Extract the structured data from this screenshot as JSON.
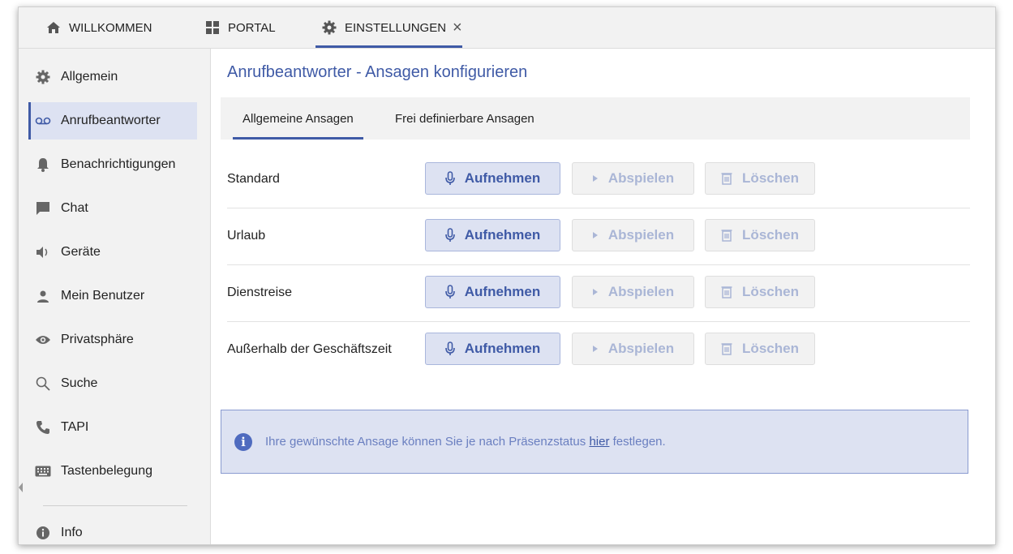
{
  "top_tabs": [
    {
      "label": "WILLKOMMEN",
      "icon": "home-icon"
    },
    {
      "label": "PORTAL",
      "icon": "grid-icon"
    },
    {
      "label": "EINSTELLUNGEN",
      "icon": "gear-icon",
      "active": true,
      "closable": true
    }
  ],
  "sidebar": {
    "items": [
      {
        "label": "Allgemein",
        "icon": "gear-icon"
      },
      {
        "label": "Anrufbeantworter",
        "icon": "voicemail-icon",
        "active": true
      },
      {
        "label": "Benachrichtigungen",
        "icon": "bell-icon"
      },
      {
        "label": "Chat",
        "icon": "chat-icon"
      },
      {
        "label": "Geräte",
        "icon": "speaker-icon"
      },
      {
        "label": "Mein Benutzer",
        "icon": "user-icon"
      },
      {
        "label": "Privatsphäre",
        "icon": "eye-icon"
      },
      {
        "label": "Suche",
        "icon": "search-icon"
      },
      {
        "label": "TAPI",
        "icon": "phone-icon"
      },
      {
        "label": "Tastenbelegung",
        "icon": "keyboard-icon"
      },
      {
        "label": "Info",
        "icon": "info-icon"
      }
    ]
  },
  "main": {
    "title": "Anrufbeantworter - Ansagen konfigurieren",
    "subtabs": [
      {
        "label": "Allgemeine Ansagen",
        "active": true
      },
      {
        "label": "Frei definierbare Ansagen"
      }
    ],
    "buttons": {
      "record": "Aufnehmen",
      "play": "Abspielen",
      "delete": "Löschen"
    },
    "rows": [
      {
        "label": "Standard"
      },
      {
        "label": "Urlaub"
      },
      {
        "label": "Dienstreise"
      },
      {
        "label": "Außerhalb der Geschäftszeit"
      }
    ],
    "info": {
      "text_before": "Ihre gewünschte Ansage können Sie je nach Präsenzstatus ",
      "link": "hier",
      "text_after": " festlegen."
    }
  },
  "colors": {
    "accent": "#3f5aa6",
    "accent_light": "#dde2f2",
    "disabled_text": "#aab6d6"
  }
}
